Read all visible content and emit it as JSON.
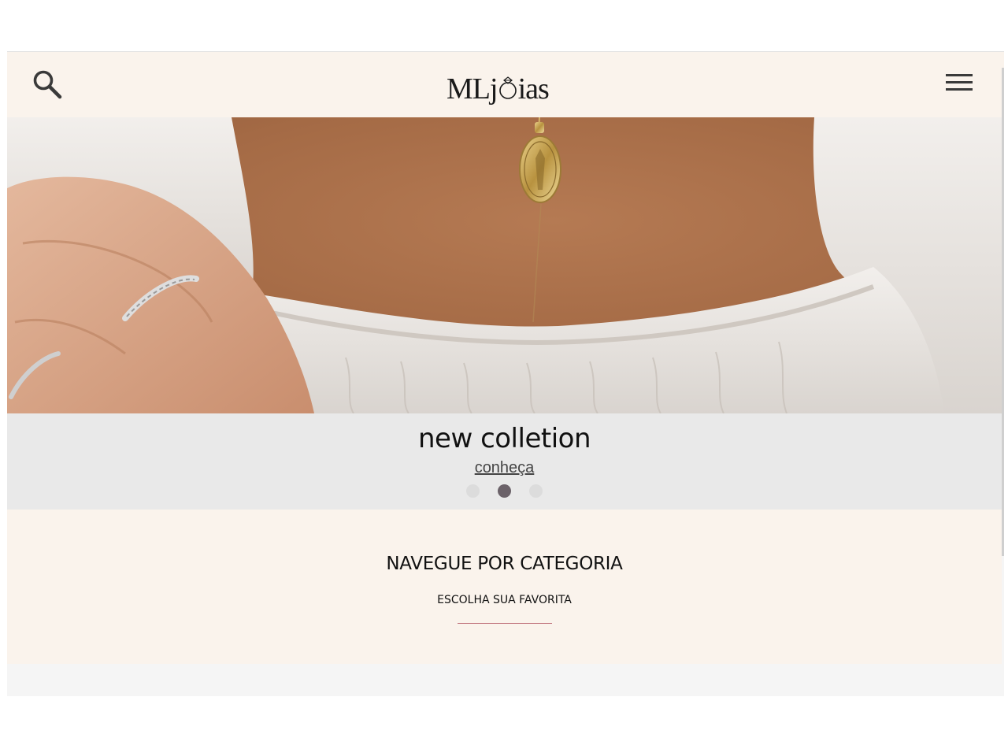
{
  "header": {
    "logo_text_left": "MLj",
    "logo_text_right": "ias",
    "search_icon": "search-icon",
    "menu_icon": "hamburger-menu-icon"
  },
  "hero": {
    "image_description_icon": "hero-banner-image"
  },
  "slide": {
    "title": "new colletion",
    "link_label": "conheça",
    "dots_count": 3,
    "active_dot": 2
  },
  "category": {
    "title": "NAVEGUE POR CATEGORIA",
    "subtitle": "ESCOLHA SUA FAVORITA",
    "divider_color": "#b9646f"
  },
  "colors": {
    "header_bg": "#faf3ec",
    "caption_bg": "#e9e9e9",
    "active_dot": "#6b6269",
    "inactive_dot": "#dcdcdc"
  }
}
